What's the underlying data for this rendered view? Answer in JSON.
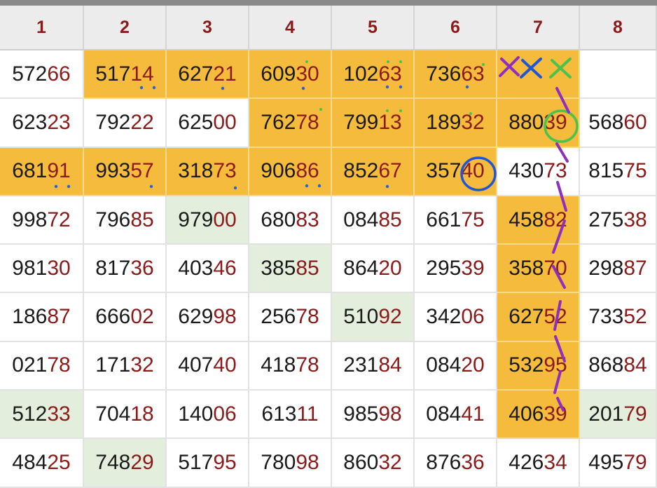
{
  "headers": [
    "1",
    "2",
    "3",
    "4",
    "5",
    "6",
    "7",
    "8"
  ],
  "colors": {
    "highlight_orange": "#f4bb3c",
    "highlight_green": "#e3efdc",
    "number_prefix": "#1a1a1a",
    "number_suffix": "#8b1a1a",
    "header_text": "#8b1a1a",
    "mark_purple": "#8e2fbf",
    "mark_blue": "#1f56d8",
    "mark_green": "#4cc24c"
  },
  "rows": [
    [
      {
        "pre": "572",
        "suf": "66",
        "bg": "white"
      },
      {
        "pre": "517",
        "suf": "14",
        "bg": "orange"
      },
      {
        "pre": "627",
        "suf": "21",
        "bg": "orange"
      },
      {
        "pre": "609",
        "suf": "30",
        "bg": "orange"
      },
      {
        "pre": "102",
        "suf": "63",
        "bg": "orange"
      },
      {
        "pre": "736",
        "suf": "63",
        "bg": "orange"
      },
      {
        "pre": "",
        "suf": "",
        "bg": "orange"
      },
      {
        "pre": "",
        "suf": "",
        "bg": "white"
      }
    ],
    [
      {
        "pre": "623",
        "suf": "23",
        "bg": "white"
      },
      {
        "pre": "792",
        "suf": "22",
        "bg": "white"
      },
      {
        "pre": "625",
        "suf": "00",
        "bg": "white"
      },
      {
        "pre": "762",
        "suf": "78",
        "bg": "orange"
      },
      {
        "pre": "799",
        "suf": "13",
        "bg": "orange"
      },
      {
        "pre": "189",
        "suf": "32",
        "bg": "orange"
      },
      {
        "pre": "880",
        "suf": "39",
        "bg": "orange"
      },
      {
        "pre": "568",
        "suf": "60",
        "bg": "white"
      }
    ],
    [
      {
        "pre": "681",
        "suf": "91",
        "bg": "orange"
      },
      {
        "pre": "993",
        "suf": "57",
        "bg": "orange"
      },
      {
        "pre": "318",
        "suf": "73",
        "bg": "orange"
      },
      {
        "pre": "906",
        "suf": "86",
        "bg": "orange"
      },
      {
        "pre": "852",
        "suf": "67",
        "bg": "orange"
      },
      {
        "pre": "357",
        "suf": "40",
        "bg": "orange"
      },
      {
        "pre": "430",
        "suf": "73",
        "bg": "white"
      },
      {
        "pre": "815",
        "suf": "75",
        "bg": "white"
      }
    ],
    [
      {
        "pre": "998",
        "suf": "72",
        "bg": "white"
      },
      {
        "pre": "796",
        "suf": "85",
        "bg": "white"
      },
      {
        "pre": "979",
        "suf": "00",
        "bg": "green"
      },
      {
        "pre": "680",
        "suf": "83",
        "bg": "white"
      },
      {
        "pre": "084",
        "suf": "85",
        "bg": "white"
      },
      {
        "pre": "661",
        "suf": "75",
        "bg": "white"
      },
      {
        "pre": "458",
        "suf": "82",
        "bg": "orange"
      },
      {
        "pre": "275",
        "suf": "38",
        "bg": "white"
      }
    ],
    [
      {
        "pre": "981",
        "suf": "30",
        "bg": "white"
      },
      {
        "pre": "817",
        "suf": "36",
        "bg": "white"
      },
      {
        "pre": "403",
        "suf": "46",
        "bg": "white"
      },
      {
        "pre": "385",
        "suf": "85",
        "bg": "green"
      },
      {
        "pre": "864",
        "suf": "20",
        "bg": "white"
      },
      {
        "pre": "295",
        "suf": "39",
        "bg": "white"
      },
      {
        "pre": "358",
        "suf": "70",
        "bg": "orange"
      },
      {
        "pre": "298",
        "suf": "87",
        "bg": "white"
      }
    ],
    [
      {
        "pre": "186",
        "suf": "87",
        "bg": "white"
      },
      {
        "pre": "666",
        "suf": "02",
        "bg": "white"
      },
      {
        "pre": "629",
        "suf": "98",
        "bg": "white"
      },
      {
        "pre": "256",
        "suf": "78",
        "bg": "white"
      },
      {
        "pre": "510",
        "suf": "92",
        "bg": "green"
      },
      {
        "pre": "342",
        "suf": "06",
        "bg": "white"
      },
      {
        "pre": "627",
        "suf": "52",
        "bg": "orange"
      },
      {
        "pre": "733",
        "suf": "52",
        "bg": "white"
      }
    ],
    [
      {
        "pre": "021",
        "suf": "78",
        "bg": "white"
      },
      {
        "pre": "171",
        "suf": "32",
        "bg": "white"
      },
      {
        "pre": "407",
        "suf": "40",
        "bg": "white"
      },
      {
        "pre": "418",
        "suf": "78",
        "bg": "white"
      },
      {
        "pre": "231",
        "suf": "84",
        "bg": "white"
      },
      {
        "pre": "084",
        "suf": "20",
        "bg": "white"
      },
      {
        "pre": "532",
        "suf": "95",
        "bg": "orange"
      },
      {
        "pre": "868",
        "suf": "84",
        "bg": "white"
      }
    ],
    [
      {
        "pre": "512",
        "suf": "33",
        "bg": "green"
      },
      {
        "pre": "704",
        "suf": "18",
        "bg": "white"
      },
      {
        "pre": "140",
        "suf": "06",
        "bg": "white"
      },
      {
        "pre": "613",
        "suf": "11",
        "bg": "white"
      },
      {
        "pre": "985",
        "suf": "98",
        "bg": "white"
      },
      {
        "pre": "084",
        "suf": "41",
        "bg": "white"
      },
      {
        "pre": "406",
        "suf": "39",
        "bg": "orange"
      },
      {
        "pre": "201",
        "suf": "79",
        "bg": "green"
      }
    ],
    [
      {
        "pre": "484",
        "suf": "25",
        "bg": "white"
      },
      {
        "pre": "748",
        "suf": "29",
        "bg": "green"
      },
      {
        "pre": "517",
        "suf": "95",
        "bg": "white"
      },
      {
        "pre": "780",
        "suf": "98",
        "bg": "white"
      },
      {
        "pre": "860",
        "suf": "32",
        "bg": "white"
      },
      {
        "pre": "876",
        "suf": "36",
        "bg": "white"
      },
      {
        "pre": "426",
        "suf": "34",
        "bg": "white"
      },
      {
        "pre": "495",
        "suf": "79",
        "bg": "white"
      }
    ]
  ]
}
